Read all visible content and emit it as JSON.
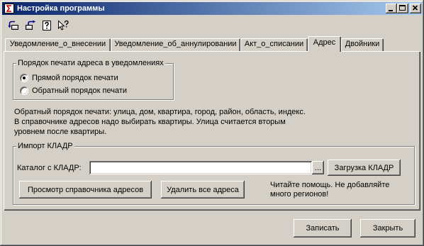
{
  "theme": {
    "face": "#d4d0c8",
    "title_start": "#0a246a",
    "title_end": "#a6caf0",
    "title_text": "#ffffff",
    "hilite": "#ffffff",
    "shadow": "#808080",
    "dark": "#404040"
  },
  "window": {
    "title": "Настройка программы",
    "icon": "app-icon",
    "controls": [
      "minimize-icon",
      "maximize-icon",
      "close-icon"
    ]
  },
  "toolbar": {
    "buttons": [
      {
        "icon": "load-settings-icon"
      },
      {
        "icon": "save-settings-icon"
      },
      {
        "icon": "help-icon"
      },
      {
        "icon": "context-help-icon"
      }
    ]
  },
  "tabs": [
    {
      "label": "Уведомление_о_внесении",
      "active": false
    },
    {
      "label": "Уведомление_об_аннулировании",
      "active": false
    },
    {
      "label": "Акт_о_списании",
      "active": false
    },
    {
      "label": "Адрес",
      "active": true
    },
    {
      "label": "Двойники",
      "active": false
    }
  ],
  "address_tab": {
    "print_order_group": {
      "title": "Порядок печати адреса в уведомлениях",
      "options": [
        {
          "label": "Прямой порядок печати",
          "selected": true
        },
        {
          "label": "Обратный порядок печати",
          "selected": false
        }
      ]
    },
    "note_lines": [
      "Обратный порядок печати: улица, дом, квартира, город, район, область, индекс.",
      "В справочнике адресов надо выбирать квартиры. Улица считается вторым",
      "уровнем после квартиры."
    ],
    "kladr_group": {
      "title": "Импорт КЛАДР",
      "catalog_label": "Каталог с КЛАДР:",
      "catalog_value": "",
      "browse_label": "...",
      "load_label": "Загрузка КЛАДР",
      "view_label": "Просмотр справочника адресов",
      "delete_label": "Удалить все адреса",
      "help_lines": [
        "Читайте помощь. Не добавляйте",
        "много регионов!"
      ]
    }
  },
  "footer": {
    "save_label": "Записать",
    "close_label": "Закрыть"
  }
}
